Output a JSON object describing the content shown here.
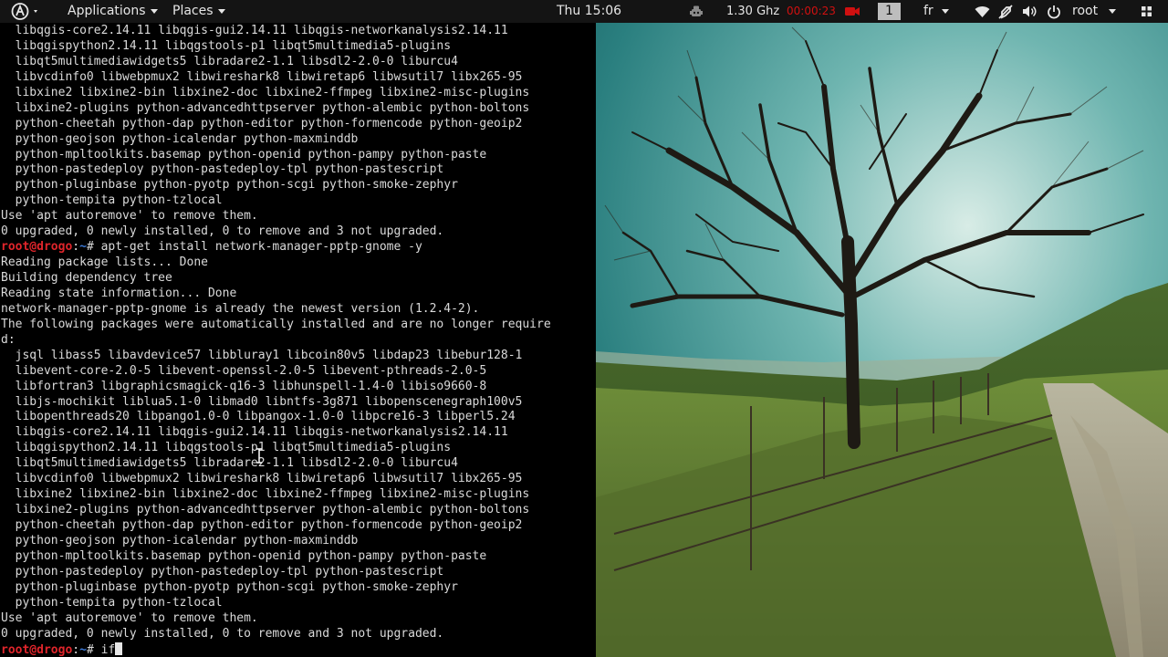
{
  "topbar": {
    "applications_label": "Applications",
    "places_label": "Places",
    "clock": "Thu 15:06",
    "cpu_freq": "1.30 Ghz",
    "timer": "00:00:23",
    "workspace": "1",
    "keyboard_layout": "fr",
    "user": "root",
    "accent_red": "#d01010"
  },
  "terminal": {
    "prompt_user": "root@drogo",
    "prompt_sep": ":",
    "prompt_path": "~",
    "prompt_symbol": "#",
    "lines": [
      {
        "kind": "text",
        "text": "  libqgis-core2.14.11 libqgis-gui2.14.11 libqgis-networkanalysis2.14.11"
      },
      {
        "kind": "text",
        "text": "  libqgispython2.14.11 libqgstools-p1 libqt5multimedia5-plugins"
      },
      {
        "kind": "text",
        "text": "  libqt5multimediawidgets5 libradare2-1.1 libsdl2-2.0-0 liburcu4"
      },
      {
        "kind": "text",
        "text": "  libvcdinfo0 libwebpmux2 libwireshark8 libwiretap6 libwsutil7 libx265-95"
      },
      {
        "kind": "text",
        "text": "  libxine2 libxine2-bin libxine2-doc libxine2-ffmpeg libxine2-misc-plugins"
      },
      {
        "kind": "text",
        "text": "  libxine2-plugins python-advancedhttpserver python-alembic python-boltons"
      },
      {
        "kind": "text",
        "text": "  python-cheetah python-dap python-editor python-formencode python-geoip2"
      },
      {
        "kind": "text",
        "text": "  python-geojson python-icalendar python-maxminddb"
      },
      {
        "kind": "text",
        "text": "  python-mpltoolkits.basemap python-openid python-pampy python-paste"
      },
      {
        "kind": "text",
        "text": "  python-pastedeploy python-pastedeploy-tpl python-pastescript"
      },
      {
        "kind": "text",
        "text": "  python-pluginbase python-pyotp python-scgi python-smoke-zephyr"
      },
      {
        "kind": "text",
        "text": "  python-tempita python-tzlocal"
      },
      {
        "kind": "text",
        "text": "Use 'apt autoremove' to remove them."
      },
      {
        "kind": "text",
        "text": "0 upgraded, 0 newly installed, 0 to remove and 3 not upgraded."
      },
      {
        "kind": "prompt",
        "text": "apt-get install network-manager-pptp-gnome -y"
      },
      {
        "kind": "text",
        "text": "Reading package lists... Done"
      },
      {
        "kind": "text",
        "text": "Building dependency tree"
      },
      {
        "kind": "text",
        "text": "Reading state information... Done"
      },
      {
        "kind": "text",
        "text": "network-manager-pptp-gnome is already the newest version (1.2.4-2)."
      },
      {
        "kind": "text",
        "text": "The following packages were automatically installed and are no longer require"
      },
      {
        "kind": "text",
        "text": "d:"
      },
      {
        "kind": "text",
        "text": "  jsql libass5 libavdevice57 libbluray1 libcoin80v5 libdap23 libebur128-1"
      },
      {
        "kind": "text",
        "text": "  libevent-core-2.0-5 libevent-openssl-2.0-5 libevent-pthreads-2.0-5"
      },
      {
        "kind": "text",
        "text": "  libfortran3 libgraphicsmagick-q16-3 libhunspell-1.4-0 libiso9660-8"
      },
      {
        "kind": "text",
        "text": "  libjs-mochikit liblua5.1-0 libmad0 libntfs-3g871 libopenscenegraph100v5"
      },
      {
        "kind": "text",
        "text": "  libopenthreads20 libpango1.0-0 libpangox-1.0-0 libpcre16-3 libperl5.24"
      },
      {
        "kind": "text",
        "text": "  libqgis-core2.14.11 libqgis-gui2.14.11 libqgis-networkanalysis2.14.11"
      },
      {
        "kind": "text",
        "text": "  libqgispython2.14.11 libqgstools-p1 libqt5multimedia5-plugins"
      },
      {
        "kind": "text",
        "text": "  libqt5multimediawidgets5 libradare2-1.1 libsdl2-2.0-0 liburcu4"
      },
      {
        "kind": "text",
        "text": "  libvcdinfo0 libwebpmux2 libwireshark8 libwiretap6 libwsutil7 libx265-95"
      },
      {
        "kind": "text",
        "text": "  libxine2 libxine2-bin libxine2-doc libxine2-ffmpeg libxine2-misc-plugins"
      },
      {
        "kind": "text",
        "text": "  libxine2-plugins python-advancedhttpserver python-alembic python-boltons"
      },
      {
        "kind": "text",
        "text": "  python-cheetah python-dap python-editor python-formencode python-geoip2"
      },
      {
        "kind": "text",
        "text": "  python-geojson python-icalendar python-maxminddb"
      },
      {
        "kind": "text",
        "text": "  python-mpltoolkits.basemap python-openid python-pampy python-paste"
      },
      {
        "kind": "text",
        "text": "  python-pastedeploy python-pastedeploy-tpl python-pastescript"
      },
      {
        "kind": "text",
        "text": "  python-pluginbase python-pyotp python-scgi python-smoke-zephyr"
      },
      {
        "kind": "text",
        "text": "  python-tempita python-tzlocal"
      },
      {
        "kind": "text",
        "text": "Use 'apt autoremove' to remove them."
      },
      {
        "kind": "text",
        "text": "0 upgraded, 0 newly installed, 0 to remove and 3 not upgraded."
      },
      {
        "kind": "prompt",
        "text": "if",
        "cursor": true
      }
    ]
  },
  "icons": {
    "activities": "kali-dragon-icon",
    "cpu_monitor": "robot-icon",
    "recorder": "camera-icon",
    "wifi": "wifi-icon",
    "vpn": "vpn-off-icon",
    "volume": "volume-icon",
    "power": "power-icon",
    "grid": "app-grid-icon"
  }
}
